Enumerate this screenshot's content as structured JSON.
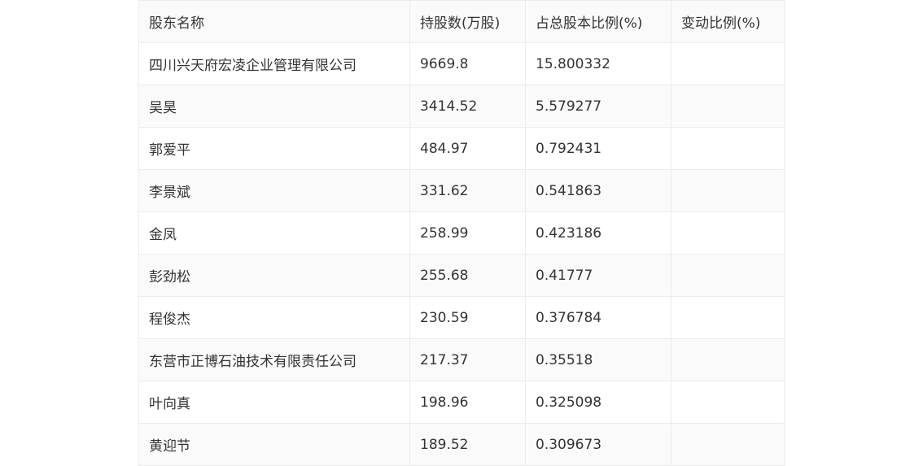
{
  "table": {
    "headers": [
      "股东名称",
      "持股数(万股)",
      "占总股本比例(%)",
      "变动比例(%)"
    ],
    "rows": [
      [
        "四川兴天府宏凌企业管理有限公司",
        "9669.8",
        "15.800332",
        ""
      ],
      [
        "吴昊",
        "3414.52",
        "5.579277",
        ""
      ],
      [
        "郭爱平",
        "484.97",
        "0.792431",
        ""
      ],
      [
        "李景斌",
        "331.62",
        "0.541863",
        ""
      ],
      [
        "金凤",
        "258.99",
        "0.423186",
        ""
      ],
      [
        "彭劲松",
        "255.68",
        "0.41777",
        ""
      ],
      [
        "程俊杰",
        "230.59",
        "0.376784",
        ""
      ],
      [
        "东营市正博石油技术有限责任公司",
        "217.37",
        "0.35518",
        ""
      ],
      [
        "叶向真",
        "198.96",
        "0.325098",
        ""
      ],
      [
        "黄迎节",
        "189.52",
        "0.309673",
        ""
      ]
    ]
  }
}
